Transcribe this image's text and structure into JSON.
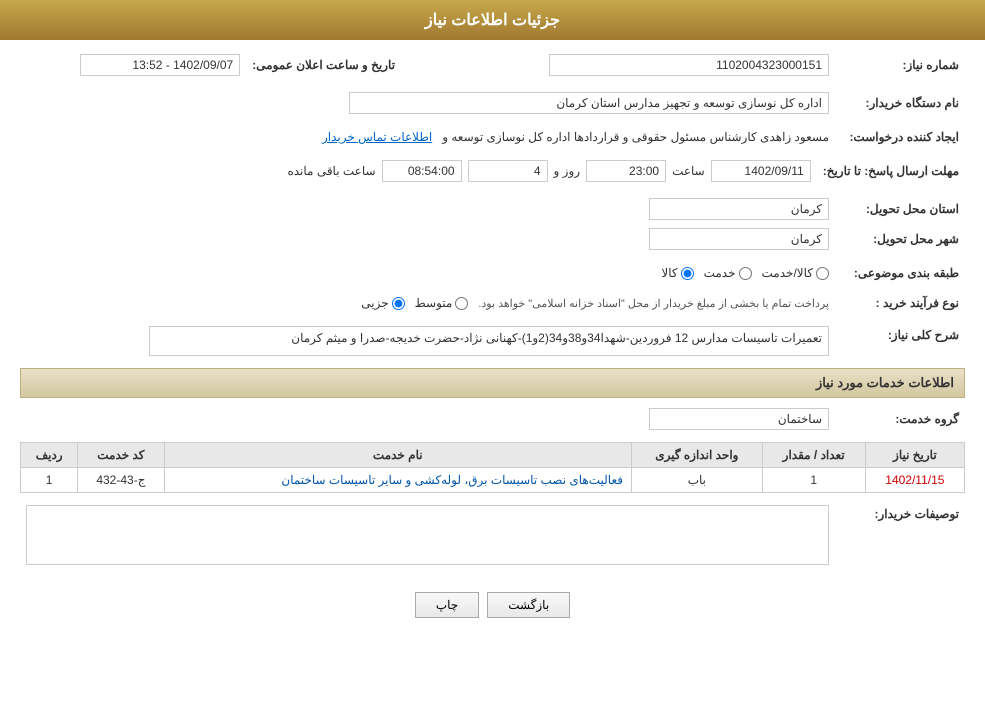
{
  "header": {
    "title": "جزئیات اطلاعات نیاز"
  },
  "fields": {
    "shomare_niaz_label": "شماره نیاز:",
    "shomare_niaz_value": "1102004323000151",
    "nam_dastgah_label": "نام دستگاه خریدار:",
    "nam_dastgah_value": "اداره کل نوسازی  توسعه و تجهیز مدارس استان کرمان",
    "ijad_konande_label": "ایجاد کننده درخواست:",
    "ijad_konande_value": "مسعود زاهدی کارشناس مسئول حقوقی و قراردادها اداره کل نوسازی  توسعه و",
    "ettelaat_tamas_label": "اطلاعات تماس خریدار",
    "mohlat_label": "مهلت ارسال پاسخ: تا تاریخ:",
    "tarikh_value": "1402/09/11",
    "saat_label": "ساعت",
    "saat_value": "23:00",
    "roz_label": "روز و",
    "roz_value": "4",
    "maande_saat_label": "ساعت باقی مانده",
    "maande_value": "08:54:00",
    "tarikh_elan_label": "تاریخ و ساعت اعلان عمومی:",
    "tarikh_elan_value": "1402/09/07 - 13:52",
    "ostan_label": "استان محل تحویل:",
    "ostan_value": "کرمان",
    "shahr_label": "شهر محل تحویل:",
    "shahr_value": "کرمان",
    "tabaghebandi_label": "طبقه بندی موضوعی:",
    "kala_label": "کالا",
    "khedmat_label": "خدمت",
    "kala_khedmat_label": "کالا/خدمت",
    "noee_farayand_label": "نوع فرآیند خرید :",
    "jozi_label": "جزیی",
    "motovaset_label": "متوسط",
    "noee_notice": "پرداخت تمام یا بخشی از مبلغ خریدار از محل \"اسناد خزانه اسلامی\" خواهد بود.",
    "sharh_label": "شرح کلی نیاز:",
    "sharh_value": "تعمیرات تاسیسات مدارس 12 فروردین-شهدا34و38و34(2و1)-کهنانی نژاد-حضرت خدیجه-صدرا و میثم کرمان",
    "khadamat_section": "اطلاعات خدمات مورد نیاز",
    "grohe_khedmat_label": "گروه خدمت:",
    "grohe_khedmat_value": "ساختمان",
    "table_headers": {
      "radif": "ردیف",
      "kod_khedmat": "کد خدمت",
      "name_khedmat": "نام خدمت",
      "vahed": "واحد اندازه گیری",
      "tedad": "تعداد / مقدار",
      "tarikh_niaz": "تاریخ نیاز"
    },
    "table_rows": [
      {
        "radif": "1",
        "kod_khedmat": "ج-43-432",
        "name_khedmat": "فعالیت‌های نصب تاسیسات برق، لوله‌کشی و سایر تاسیسات ساختمان",
        "vahed": "باب",
        "tedad": "1",
        "tarikh_niaz": "1402/11/15"
      }
    ],
    "tosif_label": "توصیفات خریدار:",
    "btn_chap": "چاپ",
    "btn_bazgasht": "بازگشت"
  }
}
